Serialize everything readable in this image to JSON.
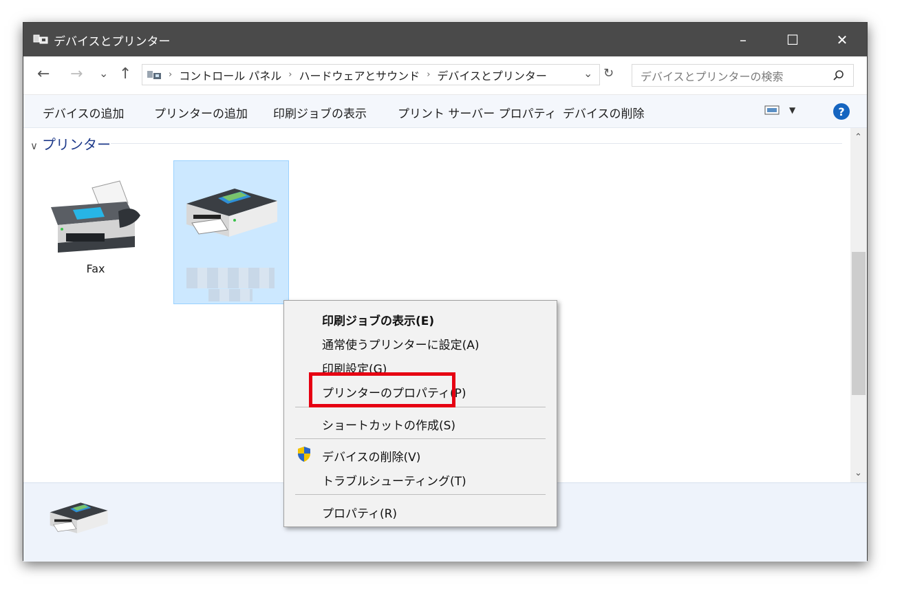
{
  "window": {
    "title": "デバイスとプリンター",
    "minimize": "–",
    "maximize": "☐",
    "close": "✕"
  },
  "nav": {
    "back": "←",
    "forward": "→",
    "recent": "⌄",
    "up": "↑",
    "dropdown": "⌄",
    "refresh": "↻"
  },
  "breadcrumb": [
    "コントロール パネル",
    "ハードウェアとサウンド",
    "デバイスとプリンター"
  ],
  "search": {
    "placeholder": "デバイスとプリンターの検索"
  },
  "toolbar": {
    "items": [
      "デバイスの追加",
      "プリンターの追加",
      "印刷ジョブの表示",
      "プリント サーバー プロパティ",
      "デバイスの削除"
    ],
    "help": "?"
  },
  "group": {
    "label": "プリンター"
  },
  "devices": [
    {
      "label": "Fax"
    }
  ],
  "context_menu": {
    "items": [
      "印刷ジョブの表示(E)",
      "通常使うプリンターに設定(A)",
      "印刷設定(G)",
      "プリンターのプロパティ(P)",
      "ショートカットの作成(S)",
      "デバイスの削除(V)",
      "トラブルシューティング(T)",
      "プロパティ(R)"
    ]
  },
  "colors": {
    "highlight": "#e60012",
    "selection": "#cce8ff",
    "link": "#1e3a8a"
  }
}
